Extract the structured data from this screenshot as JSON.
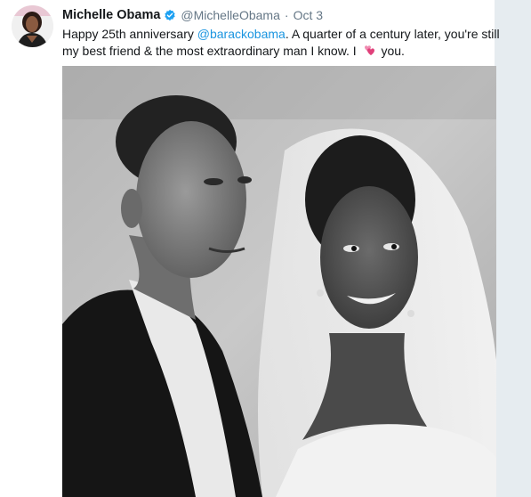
{
  "tweet": {
    "display_name": "Michelle Obama",
    "handle": "@MichelleObama",
    "separator": "·",
    "date": "Oct 3",
    "text_before": "Happy 25th anniversary ",
    "mention": "@barackobama",
    "text_after": ". A quarter of a century later, you're still my best friend & the most extraordinary man I know. I ",
    "text_end": " you.",
    "emoji_name": "two-hearts-icon"
  },
  "colors": {
    "mention": "#1b95e0",
    "secondary_text": "#657786",
    "verified_badge": "#1da1f2",
    "heart": "#e0407a"
  }
}
